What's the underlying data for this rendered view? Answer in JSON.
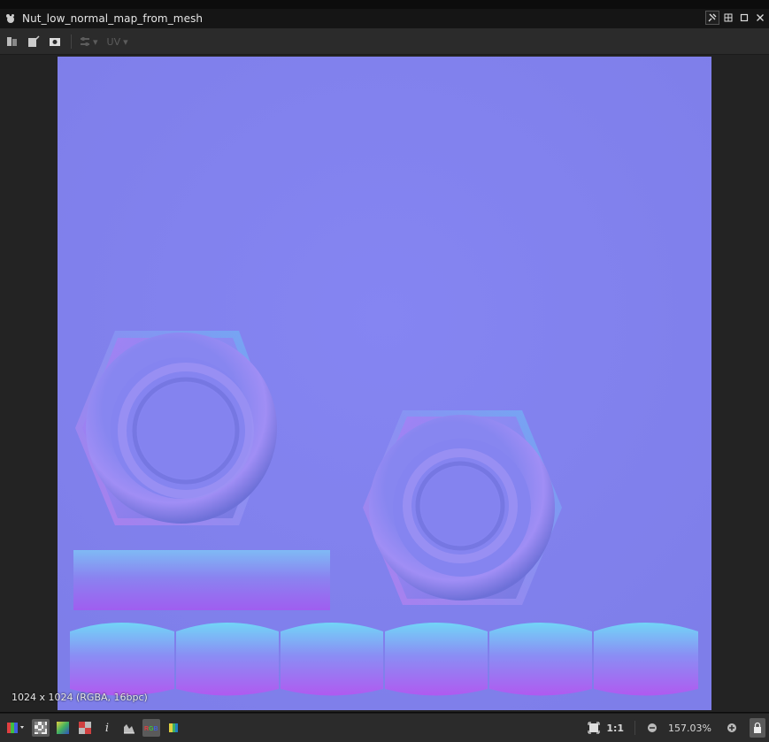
{
  "window": {
    "title": "Nut_low_normal_map_from_mesh",
    "buttons": [
      "pin-icon",
      "maximize-grid-icon",
      "maximize-icon",
      "close-icon"
    ]
  },
  "toolbar": {
    "items": [
      "channels-icon",
      "export-icon",
      "snapshot-icon",
      "transform-icon"
    ],
    "uv_label": "UV"
  },
  "viewport": {
    "size_readout": "1024 x 1024 (RGBA, 16bpc)",
    "colors": {
      "normal_base": "#8080ee",
      "background": "#232323"
    }
  },
  "statusbar": {
    "left_buttons": [
      "color-mode-icon",
      "checker-icon",
      "gradient-icon",
      "alpha-icon",
      "info-icon",
      "histogram-icon",
      "rgb-icon",
      "channel-swatch-icon"
    ],
    "ratio_label": "1:1",
    "zoom_value": "157.03%"
  }
}
